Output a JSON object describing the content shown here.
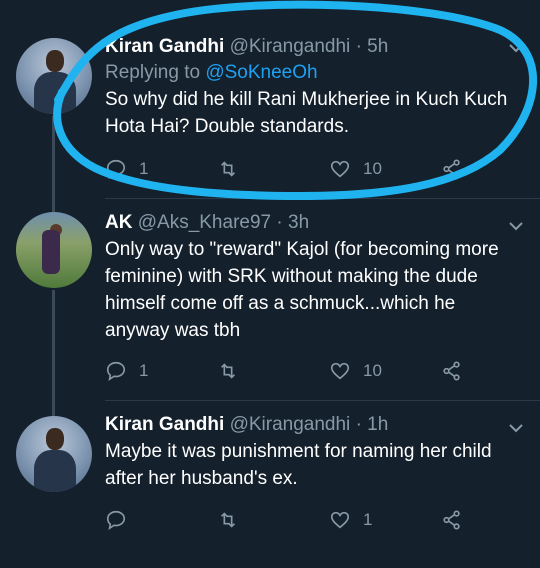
{
  "tweets": [
    {
      "name": "Kiran Gandhi",
      "handle": "@Kirangandhi",
      "dot": "·",
      "time": "5h",
      "reply_prefix": "Replying to ",
      "reply_handle": "@SoKneeOh",
      "text": "So why did he kill Rani Mukherjee in Kuch Kuch Hota Hai? Double standards.",
      "reply_count": "1",
      "like_count": "10"
    },
    {
      "name": "AK",
      "handle": "@Aks_Khare97",
      "dot": "·",
      "time": "3h",
      "text": "Only way to \"reward\" Kajol (for becoming more feminine) with SRK without making the dude himself come off as a schmuck...which he anyway was tbh",
      "reply_count": "1",
      "like_count": "10"
    },
    {
      "name": "Kiran Gandhi",
      "handle": "@Kirangandhi",
      "dot": "·",
      "time": "1h",
      "text": "Maybe it was punishment for naming her child after her husband's ex.",
      "like_count": "1"
    }
  ],
  "icons": [
    "reply-icon",
    "retweet-icon",
    "like-icon",
    "share-icon",
    "chevron-down-icon"
  ],
  "colors": {
    "background": "#14202c",
    "secondary_text": "#8899a6",
    "link": "#1da1f2",
    "annotation_circle": "#1fb3f0"
  }
}
